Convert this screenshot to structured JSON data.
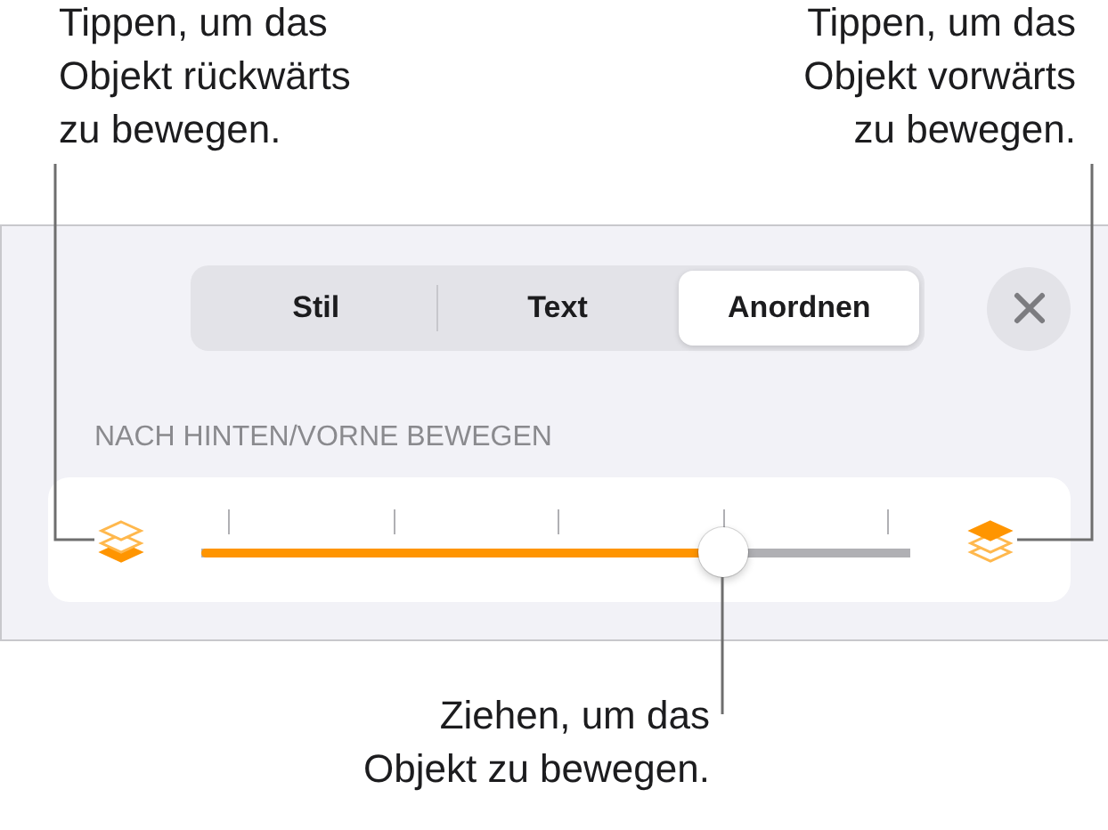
{
  "callouts": [
    {
      "text": "Tippen, um das\nObjekt rückwärts\nzu bewegen.",
      "kind": "left"
    },
    {
      "text": "Tippen, um das\nObjekt vorwärts\nzu bewegen.",
      "kind": "right"
    },
    {
      "text": "Ziehen, um das\nObjekt zu bewegen.",
      "kind": "bottom"
    }
  ],
  "tabs": [
    {
      "label": "Stil",
      "selected": false
    },
    {
      "label": "Text",
      "selected": false
    },
    {
      "label": "Anordnen",
      "selected": true
    }
  ],
  "section_label": "NACH HINTEN/VORNE BEWEGEN",
  "slider": {
    "level": 0.735
  }
}
